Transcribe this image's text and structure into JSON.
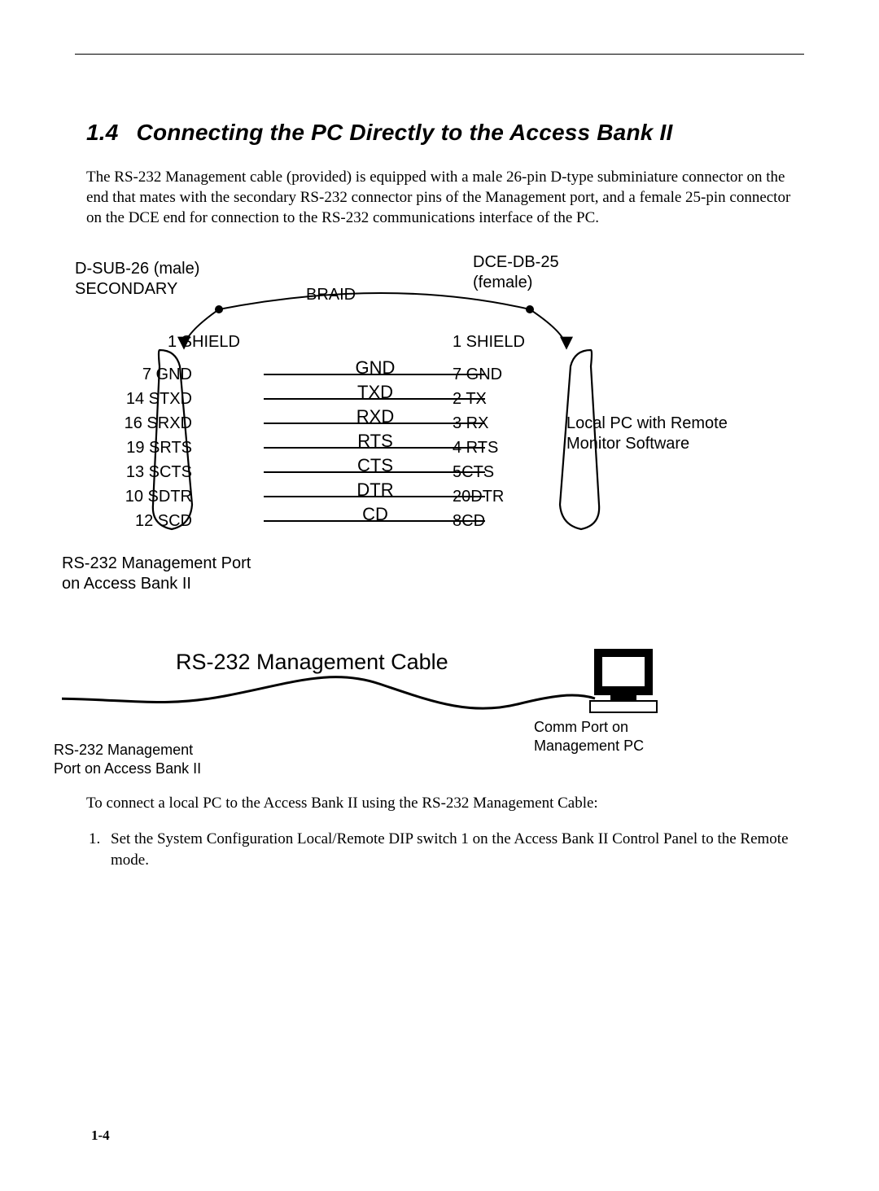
{
  "section": {
    "number": "1.4",
    "title": "Connecting the PC Directly to the Access Bank II"
  },
  "intro": "The RS-232 Management cable (provided) is equipped with a male 26-pin D-type subminiature connector on the end that mates with the secondary RS-232 connector pins of the Management port, and a female 25-pin connector on the DCE end for connection to the RS-232 communications interface of the PC.",
  "pinout": {
    "left_header_line1": "D-SUB-26 (male)",
    "left_header_line2": "SECONDARY",
    "right_header_line1": "DCE-DB-25",
    "right_header_line2": "(female)",
    "braid": "BRAID",
    "shield_left": "1 SHIELD",
    "shield_right": "1 SHIELD",
    "rows": [
      {
        "left": "7 GND",
        "sig": "GND",
        "right": "7 GND"
      },
      {
        "left": "14 STXD",
        "sig": "TXD",
        "right": "2 TX"
      },
      {
        "left": "16 SRXD",
        "sig": "RXD",
        "right": "3 RX"
      },
      {
        "left": "19 SRTS",
        "sig": "RTS",
        "right": "4 RTS"
      },
      {
        "left": "13 SCTS",
        "sig": "CTS",
        "right": "5CTS"
      },
      {
        "left": "10 SDTR",
        "sig": "DTR",
        "right": "20DTR"
      },
      {
        "left": "12 SCD",
        "sig": "CD",
        "right": "8CD"
      }
    ],
    "left_caption": "RS-232 Management Port\non Access Bank II",
    "right_caption": "Local PC with Remote\nMonitor Software"
  },
  "cable_diagram": {
    "title": "RS-232 Management Cable",
    "left_label": "RS-232 Management\nPort on Access Bank II",
    "right_label": "Comm Port on\nManagement PC"
  },
  "lead_in": "To connect a local PC to the Access Bank II using the RS-232 Management Cable:",
  "steps": [
    "Set the System Configuration Local/Remote DIP switch 1 on the Access Bank II Control Panel to the Remote mode."
  ],
  "page_number": "1-4"
}
